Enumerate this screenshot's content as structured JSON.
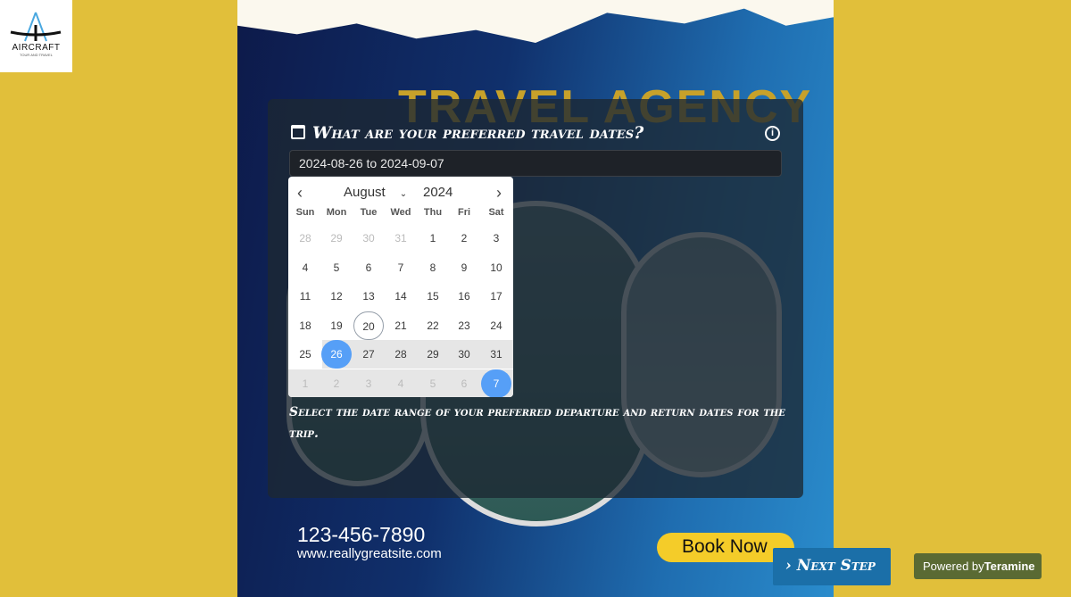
{
  "logo": {
    "text": "AIRCRAFT",
    "tagline": "TOUR AND TRAVEL"
  },
  "poster": {
    "headline": "TRAVEL AGENCY",
    "phone": "123-456-7890",
    "website": "www.reallygreatsite.com",
    "book_label": "Book Now"
  },
  "form": {
    "question": "What are your preferred travel dates?",
    "range_value": "2024-08-26 to 2024-09-07",
    "hint": "Select the date range of your preferred departure and return dates for the trip."
  },
  "calendar": {
    "month": "August",
    "year": "2024",
    "prev": "‹",
    "next": "›",
    "weekdays": [
      "Sun",
      "Mon",
      "Tue",
      "Wed",
      "Thu",
      "Fri",
      "Sat"
    ],
    "weeks": [
      [
        "28",
        "29",
        "30",
        "31",
        "1",
        "2",
        "3"
      ],
      [
        "4",
        "5",
        "6",
        "7",
        "8",
        "9",
        "10"
      ],
      [
        "11",
        "12",
        "13",
        "14",
        "15",
        "16",
        "17"
      ],
      [
        "18",
        "19",
        "20",
        "21",
        "22",
        "23",
        "24"
      ],
      [
        "25",
        "26",
        "27",
        "28",
        "29",
        "30",
        "31"
      ],
      [
        "1",
        "2",
        "3",
        "4",
        "5",
        "6",
        "7"
      ]
    ],
    "today": "2024-08-20",
    "range_start": "2024-08-26",
    "range_end": "2024-09-07",
    "accent": "#569ff7"
  },
  "next_step_label": "› Next Step",
  "powered": {
    "prefix": "Powered by",
    "brand": "Teramine"
  }
}
